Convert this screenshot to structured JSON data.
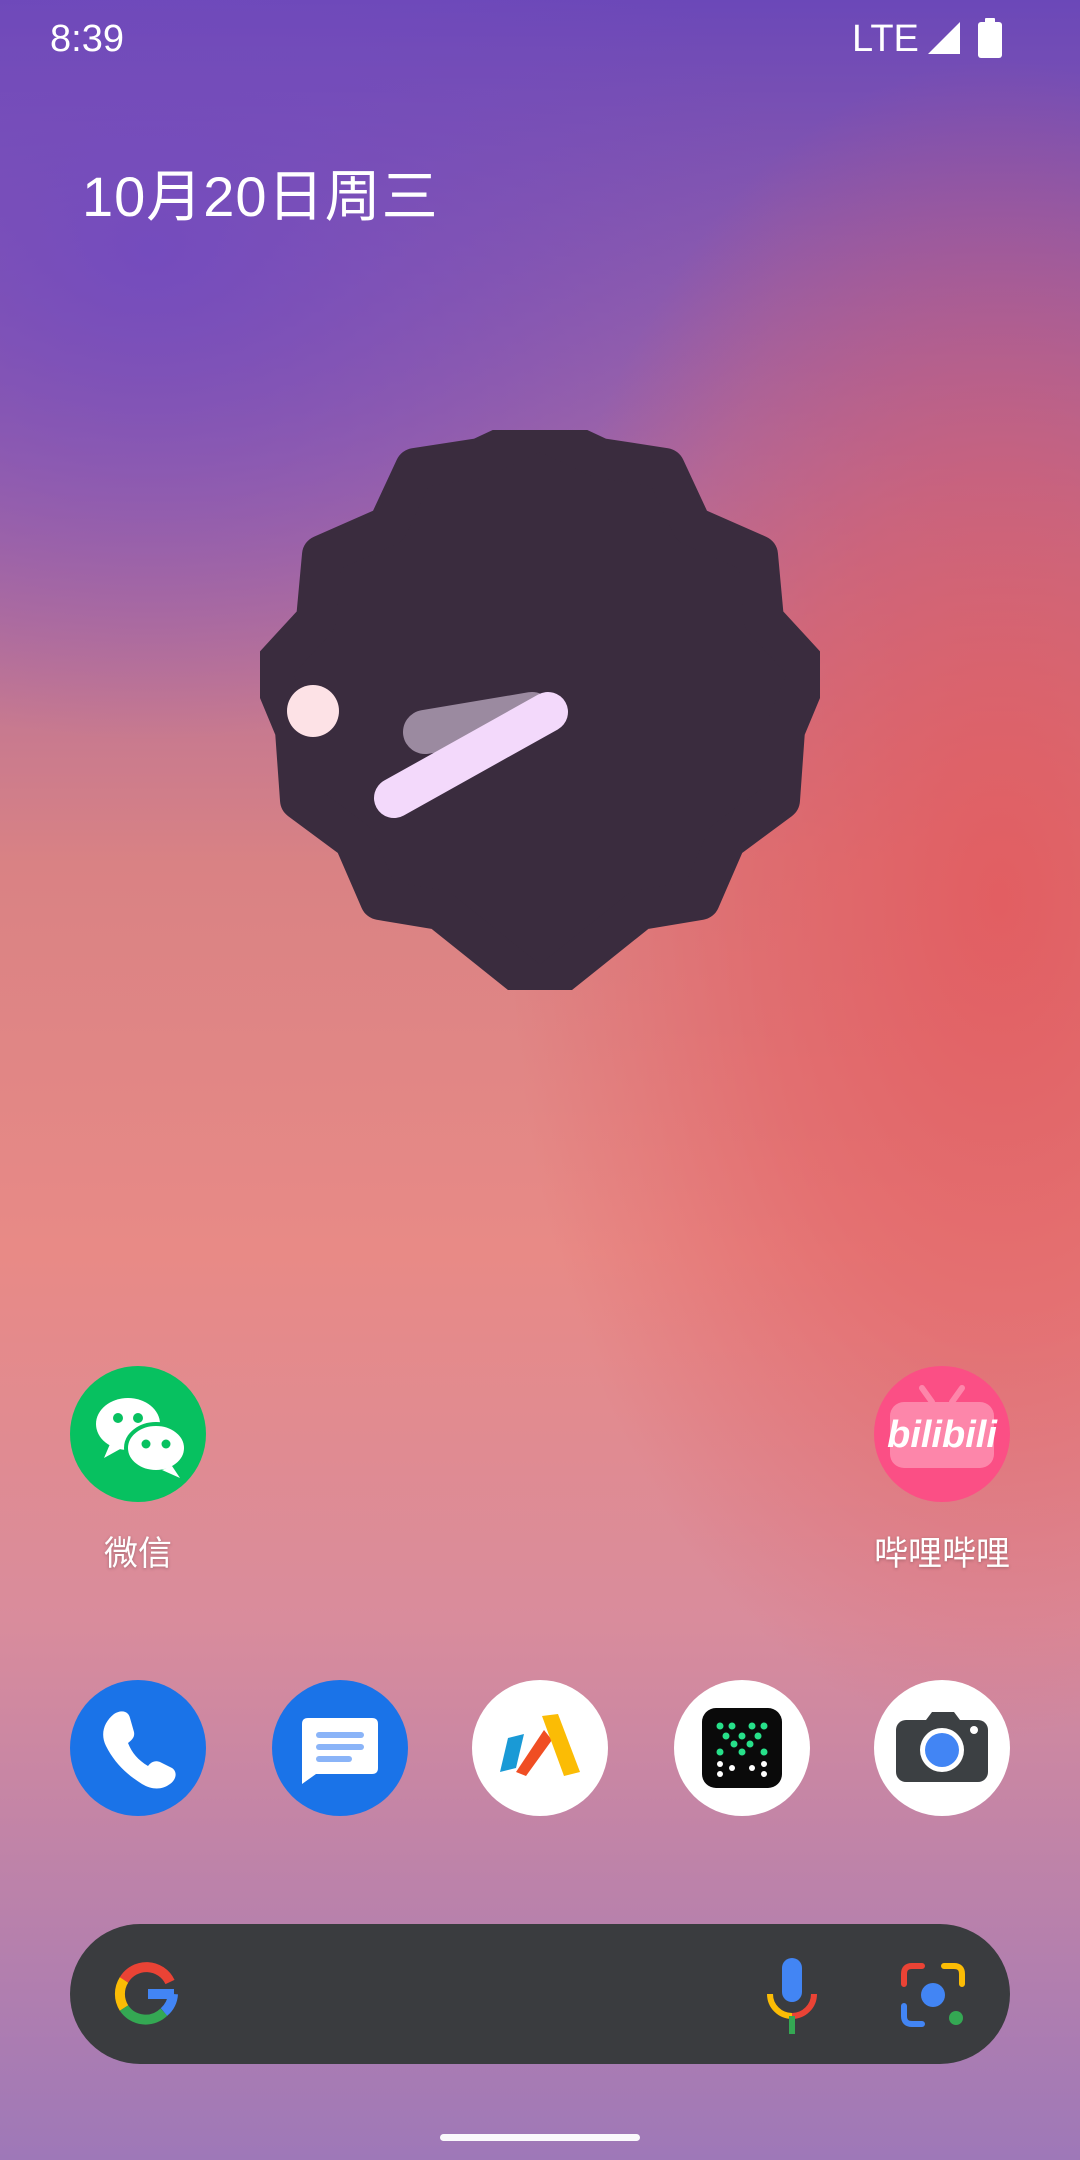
{
  "status_bar": {
    "time": "8:39",
    "network": "LTE"
  },
  "date": "10月20日周三",
  "home_apps": [
    {
      "label": "微信",
      "icon": "wechat-icon"
    },
    {
      "label": "哔哩哔哩",
      "icon": "bilibili-icon"
    }
  ],
  "bilibili_logo_text": "bilibili",
  "dock": [
    {
      "icon": "phone-icon"
    },
    {
      "icon": "messages-icon"
    },
    {
      "icon": "app-icon"
    },
    {
      "icon": "grid-app-icon"
    },
    {
      "icon": "camera-icon"
    }
  ],
  "search_bar": {
    "icons": [
      "google-g-icon",
      "mic-icon",
      "lens-icon"
    ]
  },
  "colors": {
    "clock_face": "#3a2c3e",
    "clock_hand": "#f3d9fb",
    "wechat": "#07c160",
    "bilibili": "#fb7299",
    "phone": "#1a73e8",
    "search_bg": "#3a3c3f"
  }
}
